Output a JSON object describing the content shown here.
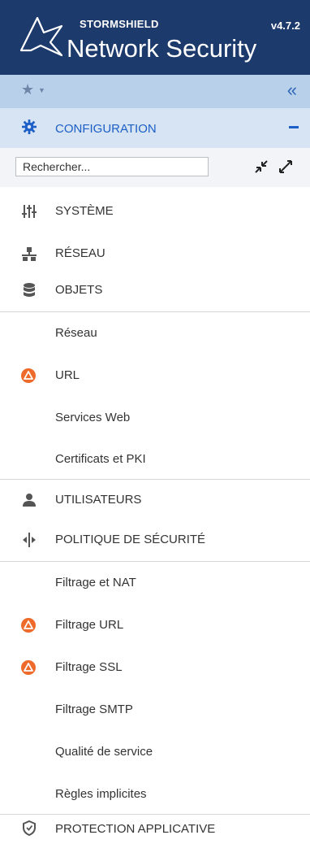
{
  "header": {
    "brand": "STORMSHIELD",
    "version": "v4.7.2",
    "product": "Network Security"
  },
  "favorites": {
    "star_icon": "star-icon",
    "caret_icon": "caret-down-icon",
    "collapse_icon": "double-chevron-left-icon"
  },
  "configuration": {
    "label": "CONFIGURATION",
    "icon": "gear-icon"
  },
  "search": {
    "placeholder": "Rechercher..."
  },
  "menu": {
    "systeme": "SYSTÈME",
    "reseau": "RÉSEAU",
    "objets": "OBJETS",
    "objets_sub": [
      "Réseau",
      "URL",
      "Services Web",
      "Certificats et PKI"
    ],
    "utilisateurs": "UTILISATEURS",
    "politique": "POLITIQUE DE SÉCURITÉ",
    "politique_sub": [
      "Filtrage et NAT",
      "Filtrage URL",
      "Filtrage SSL",
      "Filtrage SMTP",
      "Qualité de service",
      "Règles implicites"
    ],
    "protection": "PROTECTION APPLICATIVE"
  },
  "colors": {
    "header_bg": "#1d3a6c",
    "favbar_bg": "#b8d0ea",
    "config_bg": "#d6e4f3",
    "accent": "#1d5ec7",
    "warning": "#ee6a2a"
  }
}
